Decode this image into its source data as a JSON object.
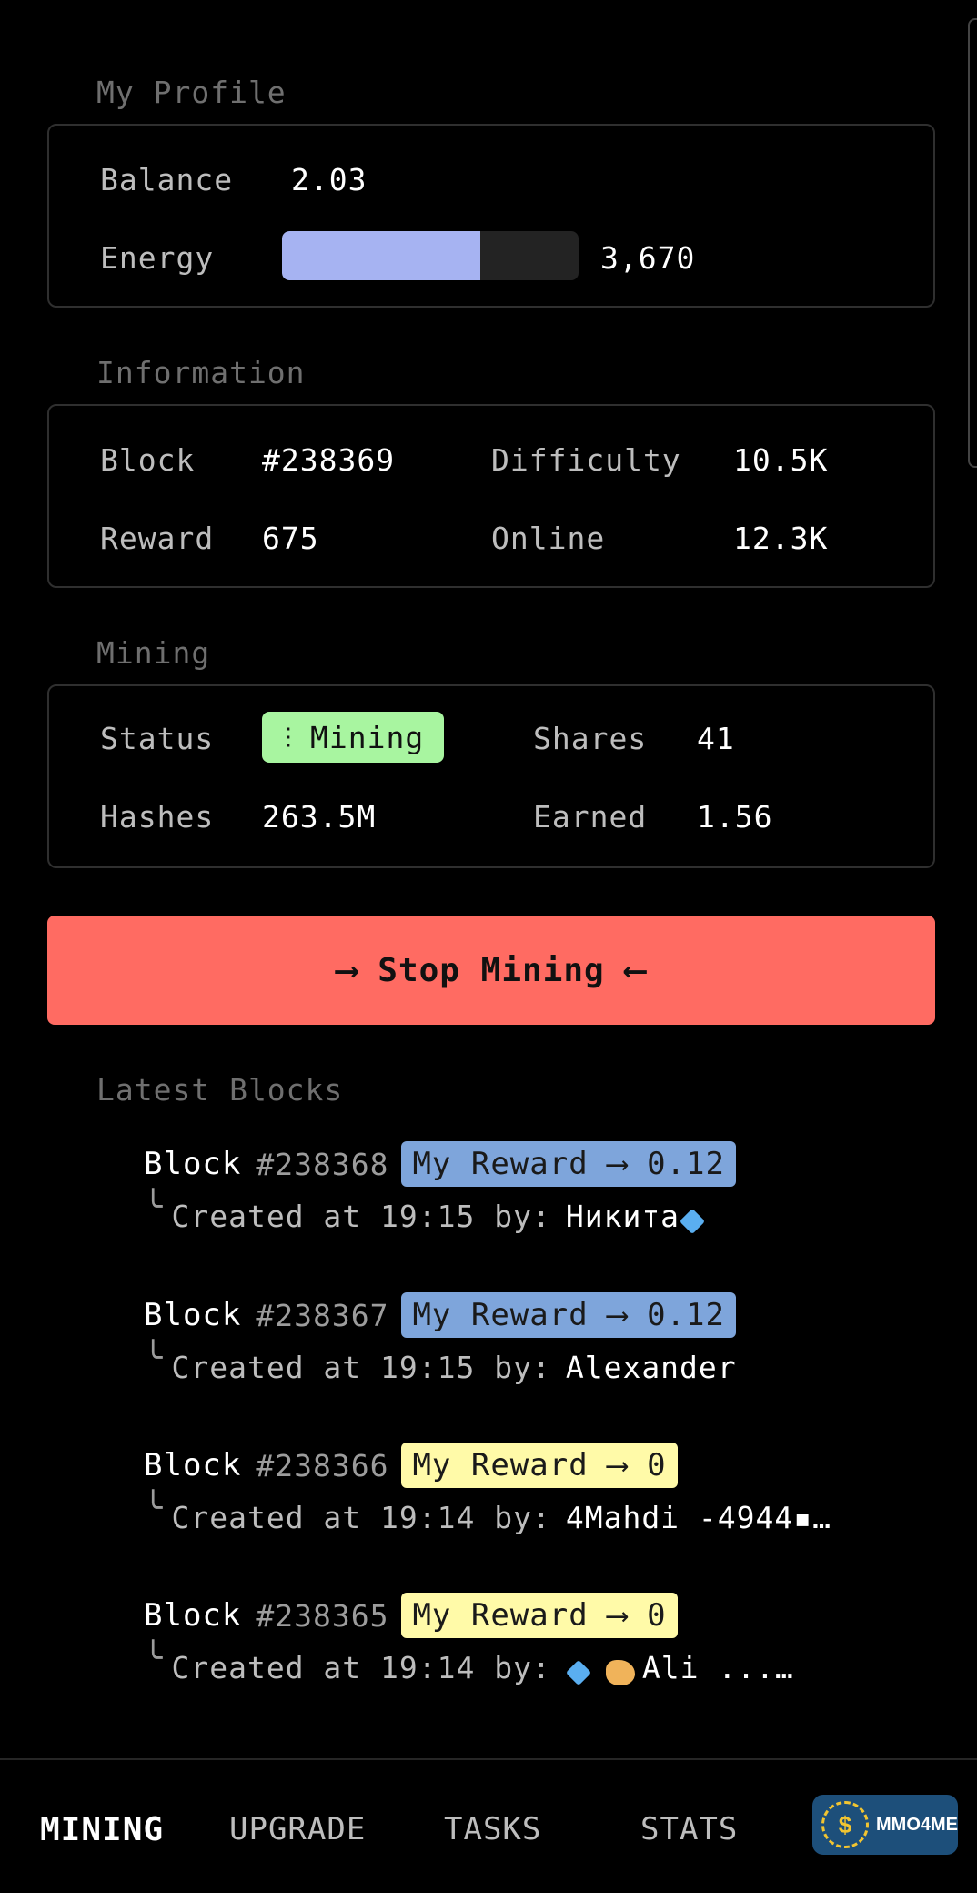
{
  "profile": {
    "title": "My Profile",
    "balance_label": "Balance",
    "balance_value": "2.03",
    "energy_label": "Energy",
    "energy_value": "3,670",
    "energy_fraction": 0.67,
    "energy_color": "#a6b3f2"
  },
  "information": {
    "title": "Information",
    "block_label": "Block",
    "block_value": "#238369",
    "difficulty_label": "Difficulty",
    "difficulty_value": "10.5K",
    "reward_label": "Reward",
    "reward_value": "675",
    "online_label": "Online",
    "online_value": "12.3K"
  },
  "mining": {
    "title": "Mining",
    "status_label": "Status",
    "status_value": "Mining",
    "status_icon": "vertical-dots-icon",
    "status_color": "#a8f5a0",
    "shares_label": "Shares",
    "shares_value": "41",
    "hashes_label": "Hashes",
    "hashes_value": "263.5M",
    "earned_label": "Earned",
    "earned_value": "1.56"
  },
  "stop_button": {
    "label": "⟶ Stop Mining ⟵",
    "color": "#ff6b62"
  },
  "latest_blocks": {
    "title": "Latest Blocks",
    "items": [
      {
        "word": "Block",
        "number": "#238368",
        "reward": "My Reward ⟶ 0.12",
        "created": "Created at 19:15 by:",
        "author": "Никита",
        "style": "blue"
      },
      {
        "word": "Block",
        "number": "#238367",
        "reward": "My Reward ⟶ 0.12",
        "created": "Created at 19:15 by:",
        "author": "Alexander",
        "style": "blue"
      },
      {
        "word": "Block",
        "number": "#238366",
        "reward": "My Reward ⟶ 0",
        "created": "Created at 19:14 by:",
        "author": "4Mahdi -4944▪…",
        "style": "yellow"
      },
      {
        "word": "Block",
        "number": "#238365",
        "reward": "My Reward ⟶ 0",
        "created": "Created at 19:14 by:",
        "author": "Ali ...…",
        "style": "yellow"
      }
    ]
  },
  "tabs": {
    "mining": "MINING",
    "upgrade": "UPGRADE",
    "tasks": "TASKS",
    "stats": "STATS"
  },
  "watermark": {
    "text": "MMO4ME",
    "symbol": "$"
  }
}
